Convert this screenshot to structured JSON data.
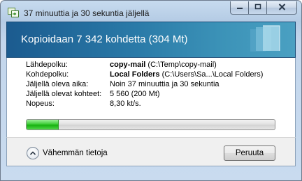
{
  "window": {
    "title": "37 minuuttia ja 30 sekuntia jäljellä",
    "icon": "copy-dialog-icon"
  },
  "header": {
    "title": "Kopioidaan 7 342 kohdetta (304 Mt)"
  },
  "info": {
    "source_label": "Lähdepolku:",
    "source_name": "copy-mail",
    "source_path": "(C:\\Temp\\copy-mail)",
    "dest_label": "Kohdepolku:",
    "dest_name": "Local Folders",
    "dest_path": "(C:\\Users\\Sa...\\Local Folders)",
    "time_label": "Jäljellä oleva aika:",
    "time_value": "Noin 37 minuuttia ja 30 sekuntia",
    "items_label": "Jäljellä olevat kohteet:",
    "items_value": "5 560 (200 Mt)",
    "speed_label": "Nopeus:",
    "speed_value": "8,30 kt/s."
  },
  "progress": {
    "fraction": 0.13,
    "color": "#16b00f"
  },
  "footer": {
    "details_label": "Vähemmän tietoja",
    "cancel_label": "Peruuta"
  }
}
